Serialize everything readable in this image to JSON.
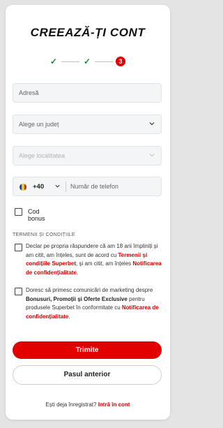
{
  "title": "CREEAZĂ-ȚI CONT",
  "stepper": {
    "current_step": "3"
  },
  "fields": {
    "address_placeholder": "Adresă",
    "county_placeholder": "Alege un județ",
    "locality_placeholder": "Alege localitatea",
    "phone_code": "+40",
    "phone_placeholder": "Număr de telefon"
  },
  "bonus_code_label": "Cod bonus",
  "terms": {
    "section_label": "TERMENII ȘI CONDIȚIILE",
    "age": {
      "text1": "Declar pe propria răspundere că am 18 ani împliniți și am citit, am înțeles, sunt de acord cu ",
      "link1": "Termenii și condițiile Superbet",
      "text2": ", și am citit, am înțeles ",
      "link2": "Notificarea de confidențialitate",
      "text3": "."
    },
    "marketing": {
      "text1": "Doresc să primesc comunicări de marketing despre ",
      "bold1": "Bonusuri, Promoții și Oferte Exclusive",
      "text2": " pentru produsele Superbet în conformitate cu ",
      "link1": "Notificarea de confidențialitate",
      "text3": "."
    }
  },
  "buttons": {
    "submit": "Trimite",
    "previous": "Pasul anterior"
  },
  "footer": {
    "question": "Ești deja înregistrat?",
    "login_link": "Intră în cont"
  },
  "colors": {
    "accent": "#e20000",
    "check_green": "#1e8a3a"
  },
  "flag_colors": [
    "#1d3f94",
    "#f4cd00",
    "#cc1126"
  ]
}
